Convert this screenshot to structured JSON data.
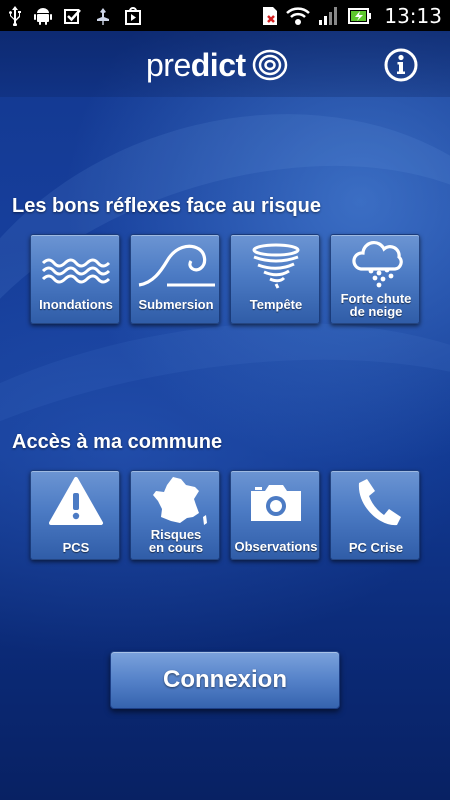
{
  "status_bar": {
    "time": "13:13",
    "left_icons": [
      "usb-icon",
      "android-icon",
      "checkbox-icon",
      "pin-icon",
      "play-store-icon"
    ],
    "right_icons": [
      "sim-missing-icon",
      "wifi-icon",
      "signal-icon",
      "battery-charging-icon"
    ]
  },
  "header": {
    "logo_pre": "pre",
    "logo_dict": "dict",
    "info_icon": "info-icon"
  },
  "section_reflexes": {
    "title": "Les bons réflexes face au risque",
    "tiles": [
      {
        "label_line1": "Inondations",
        "label_line2": "",
        "icon": "waves-icon"
      },
      {
        "label_line1": "Submersion",
        "label_line2": "",
        "icon": "wave-icon"
      },
      {
        "label_line1": "Tempête",
        "label_line2": "",
        "icon": "tornado-icon"
      },
      {
        "label_line1": "Forte chute",
        "label_line2": "de neige",
        "icon": "snow-cloud-icon"
      }
    ]
  },
  "section_commune": {
    "title": "Accès à ma commune",
    "tiles": [
      {
        "label_line1": "PCS",
        "label_line2": "",
        "icon": "warning-icon"
      },
      {
        "label_line1": "Risques",
        "label_line2": "en cours",
        "icon": "france-map-icon"
      },
      {
        "label_line1": "Observations",
        "label_line2": "",
        "icon": "camera-icon"
      },
      {
        "label_line1": "PC Crise",
        "label_line2": "",
        "icon": "phone-icon"
      }
    ]
  },
  "connexion_label": "Connexion",
  "colors": {
    "background": "#123a93",
    "tile": "#4c7bc4",
    "text": "#ffffff"
  }
}
